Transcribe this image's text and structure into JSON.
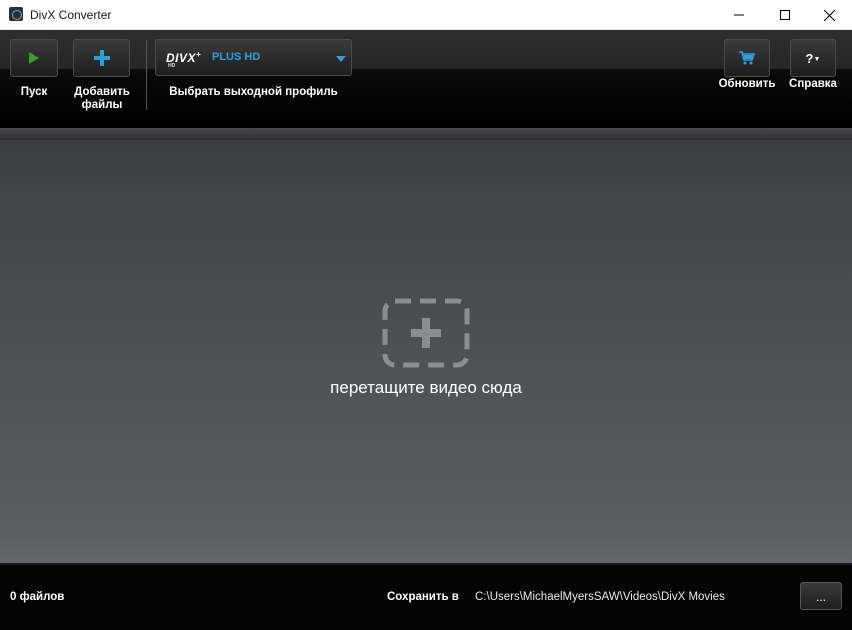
{
  "window": {
    "title": "DivX Converter"
  },
  "toolbar": {
    "start_label": "Пуск",
    "add_files_label": "Добавить файлы",
    "profile": {
      "logo": "DIVX",
      "logo_plus": "+",
      "logo_hd": "HD",
      "name": "PLUS HD",
      "label": "Выбрать выходной профиль"
    },
    "update_label": "Обновить",
    "help_label": "Справка",
    "help_glyph": "?"
  },
  "main": {
    "drop_text": "перетащите видео сюда"
  },
  "status": {
    "file_count": "0 файлов",
    "save_label": "Сохранить в",
    "save_path": "C:\\Users\\MichaelMyersSAW\\Videos\\DivX Movies",
    "browse_label": "..."
  },
  "icons": {
    "start": "play-icon",
    "add": "plus-icon",
    "update": "cart-icon",
    "help": "help-icon",
    "drop": "add-drop-icon"
  },
  "colors": {
    "accent": "#2aa0d8",
    "play": "#3a9a2a"
  }
}
